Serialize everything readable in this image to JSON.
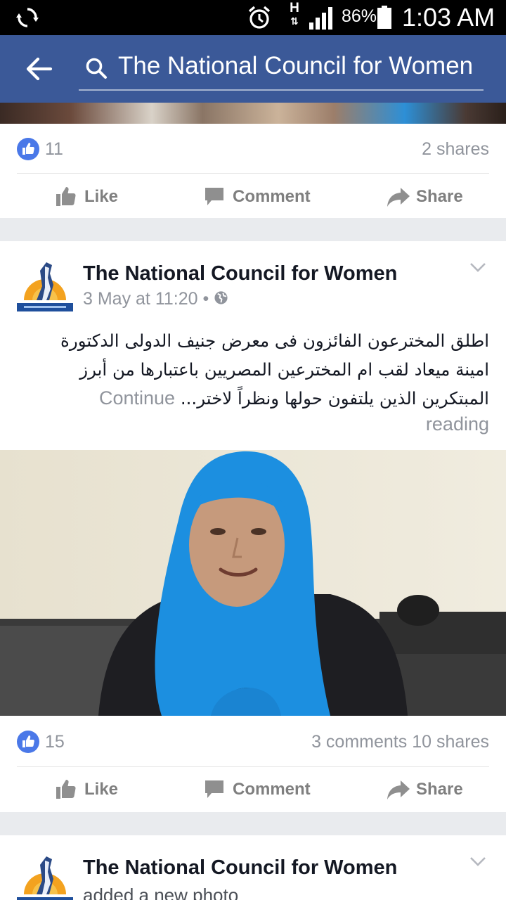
{
  "status_bar": {
    "network": "H",
    "battery": "86%",
    "time": "1:03 AM"
  },
  "search": {
    "query": "The National Council for Women"
  },
  "post_prev": {
    "likes": "11",
    "shares": "2 shares"
  },
  "actions": {
    "like": "Like",
    "comment": "Comment",
    "share": "Share"
  },
  "post_main": {
    "page_name": "The National Council for Women",
    "time": "3 May at 11:20",
    "separator": "•",
    "text_line1": "اطلق المخترعون الفائزون فى معرض جنيف الدولى الدكتورة",
    "text_line2": "امينة ميعاد لقب ام المخترعين المصريين باعتبارها من أبرز",
    "text_line3": "المبتكرين الذين يلتفون حولها ونظراً لاختر...",
    "continue_label": "Continue",
    "reading_label": "reading",
    "likes": "15",
    "comments": "3 comments",
    "shares": "10 shares"
  },
  "post_next": {
    "page_name": "The National Council for Women",
    "subtitle": "added a new photo"
  },
  "colors": {
    "facebook_blue": "#3b5998",
    "like_badge": "#4a78e8",
    "hijab_blue": "#1c8fe0"
  },
  "icons": [
    "sync-icon",
    "alarm-icon",
    "signal-icon",
    "battery-icon",
    "back-arrow-icon",
    "search-icon",
    "like-icon",
    "thumbs-up-icon",
    "comment-icon",
    "share-icon",
    "chevron-down-icon",
    "globe-icon"
  ]
}
